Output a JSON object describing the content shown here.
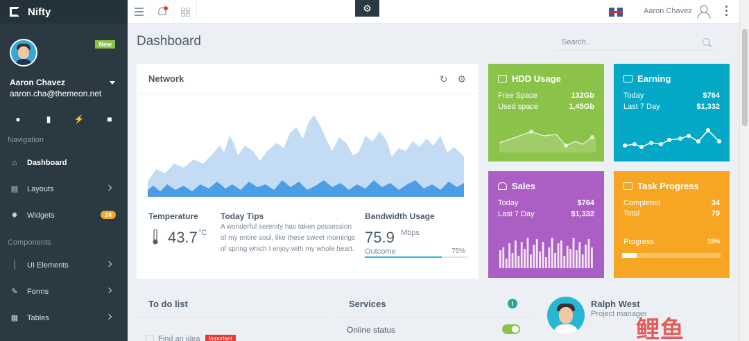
{
  "brand": {
    "name": "Nifty"
  },
  "profile": {
    "badge": "New",
    "name": "Aaron Chavez",
    "email": "aaron.cha@themeon.net"
  },
  "sidebar": {
    "nav_caption": "Navigation",
    "components_caption": "Components",
    "items": [
      {
        "label": "Dashboard",
        "icon": "home-icon"
      },
      {
        "label": "Layouts",
        "icon": "layout-icon"
      },
      {
        "label": "Widgets",
        "icon": "widget-icon",
        "count": "24"
      },
      {
        "label": "UI Elements",
        "icon": "ui-elements-icon"
      },
      {
        "label": "Forms",
        "icon": "forms-icon"
      },
      {
        "label": "Tables",
        "icon": "tables-icon"
      }
    ]
  },
  "topbar": {
    "user_name": "Aaron Chavez"
  },
  "page": {
    "title": "Dashboard",
    "search_placeholder": "Search.."
  },
  "network": {
    "title": "Network",
    "temperature_label": "Temperature",
    "temperature_value": "43.7",
    "temperature_unit": "°C",
    "tips_title": "Today Tips",
    "tips_text": "A wonderful serenity has taken possession of my entire soul, like these sweet mornings of spring which I enjoy with my whole heart.",
    "bandwidth_label": "Bandwidth Usage",
    "bandwidth_value": "75.9",
    "bandwidth_unit": "Mbps",
    "outcome_label": "Outcome",
    "outcome_pct": "75%",
    "outcome_fraction": 0.75
  },
  "tiles": {
    "hdd": {
      "title": "HDD Usage",
      "rows": [
        {
          "label": "Free Space",
          "value": "132Gb"
        },
        {
          "label": "Used space",
          "value": "1,45Gb"
        }
      ]
    },
    "earning": {
      "title": "Earning",
      "rows": [
        {
          "label": "Today",
          "value": "$764"
        },
        {
          "label": "Last 7 Day",
          "value": "$1,332"
        }
      ]
    },
    "sales": {
      "title": "Sales",
      "rows": [
        {
          "label": "Today",
          "value": "$764"
        },
        {
          "label": "Last 7 Day",
          "value": "$1,332"
        }
      ]
    },
    "task": {
      "title": "Task Progress",
      "rows": [
        {
          "label": "Completed",
          "value": "34"
        },
        {
          "label": "Total",
          "value": "79"
        }
      ],
      "progress_label": "Progress",
      "progress_pct": "15%",
      "progress_fraction": 0.15
    }
  },
  "todo": {
    "title": "To do list",
    "item": "Find an idea",
    "badge": "Important"
  },
  "services": {
    "title": "Services",
    "online_label": "Online status",
    "online": true
  },
  "contact": {
    "name": "Ralph West",
    "role": "Project manager"
  },
  "watermark": "鲤鱼",
  "colors": {
    "hdd": "#8bc34a",
    "earning": "#03a9c7",
    "sales": "#ab5ec4",
    "task": "#f6a623",
    "sidebar": "#2b3a42"
  }
}
